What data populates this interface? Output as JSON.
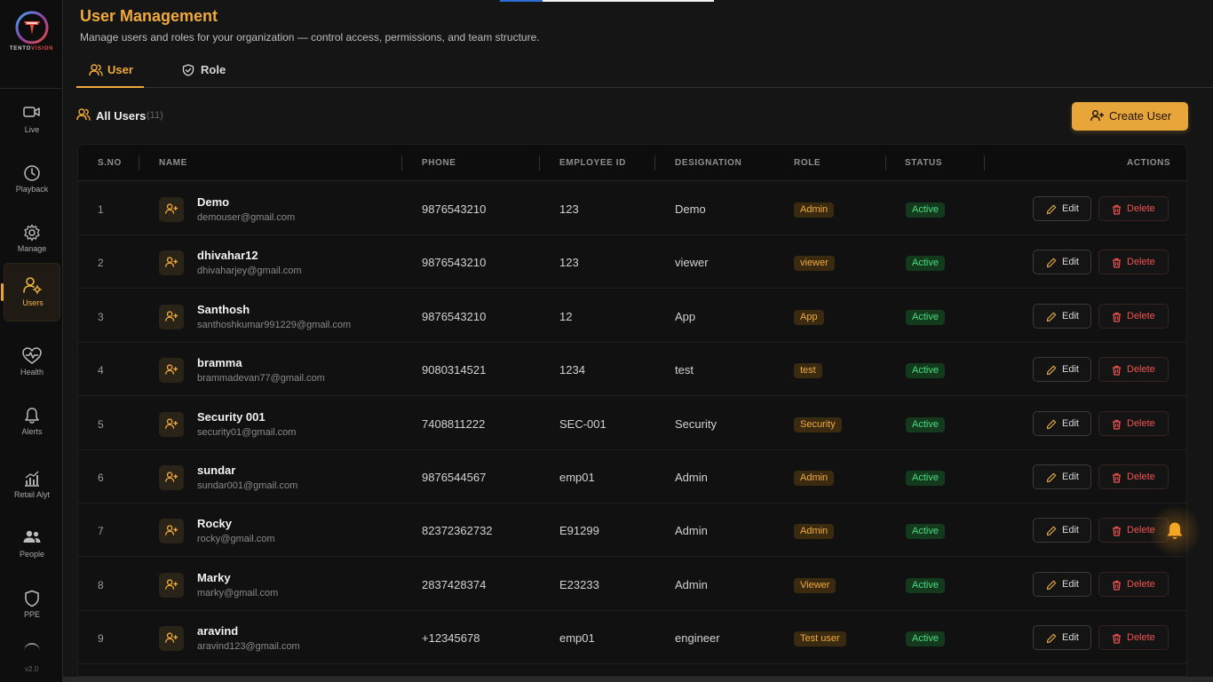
{
  "brand": {
    "name_part1": "TENTO",
    "name_part2": "VISION",
    "accent": "#f0a93a"
  },
  "sidebar": {
    "items": [
      {
        "label": "Live",
        "icon": "video-camera-icon"
      },
      {
        "label": "Playback",
        "icon": "clock-icon"
      },
      {
        "label": "Manage",
        "icon": "gear-icon"
      },
      {
        "label": "Users",
        "icon": "users-gear-icon",
        "active": true
      },
      {
        "label": "Health",
        "icon": "heart-pulse-icon"
      },
      {
        "label": "Alerts",
        "icon": "bell-icon"
      },
      {
        "label": "Retail Alyt",
        "icon": "bar-chart-icon"
      },
      {
        "label": "People",
        "icon": "people-icon"
      },
      {
        "label": "PPE",
        "icon": "shield-icon"
      }
    ],
    "version": "v2.0"
  },
  "top_progress": 0.2,
  "header": {
    "title": "User Management",
    "subtitle": "Manage users and roles for your organization — control access, permissions, and team structure."
  },
  "tabs": [
    {
      "label": "User",
      "icon": "users-icon",
      "active": true
    },
    {
      "label": "Role",
      "icon": "shield-check-icon"
    }
  ],
  "section": {
    "title": "All Users",
    "count": "(11)"
  },
  "create_button": {
    "label": "Create User",
    "icon": "user-plus-icon"
  },
  "table": {
    "columns": [
      "S.NO",
      "NAME",
      "PHONE",
      "EMPLOYEE ID",
      "DESIGNATION",
      "ROLE",
      "STATUS",
      "ACTIONS"
    ],
    "edit_label": "Edit",
    "delete_label": "Delete",
    "rows": [
      {
        "sno": "1",
        "name": "Demo",
        "email": "demouser@gmail.com",
        "phone": "9876543210",
        "emp_id": "123",
        "designation": "Demo",
        "role": "Admin",
        "status": "Active"
      },
      {
        "sno": "2",
        "name": "dhivahar12",
        "email": "dhivaharjey@gmail.com",
        "phone": "9876543210",
        "emp_id": "123",
        "designation": "viewer",
        "role": "viewer",
        "status": "Active"
      },
      {
        "sno": "3",
        "name": "Santhosh",
        "email": "santhoshkumar991229@gmail.com",
        "phone": "9876543210",
        "emp_id": "12",
        "designation": "App",
        "role": "App",
        "status": "Active"
      },
      {
        "sno": "4",
        "name": "bramma",
        "email": "brammadevan77@gmail.com",
        "phone": "9080314521",
        "emp_id": "1234",
        "designation": "test",
        "role": "test",
        "status": "Active"
      },
      {
        "sno": "5",
        "name": "Security 001",
        "email": "security01@gmail.com",
        "phone": "7408811222",
        "emp_id": "SEC-001",
        "designation": "Security",
        "role": "Security",
        "status": "Active"
      },
      {
        "sno": "6",
        "name": "sundar",
        "email": "sundar001@gmail.com",
        "phone": "9876544567",
        "emp_id": "emp01",
        "designation": "Admin",
        "role": "Admin",
        "status": "Active"
      },
      {
        "sno": "7",
        "name": "Rocky",
        "email": "rocky@gmail.com",
        "phone": "82372362732",
        "emp_id": "E91299",
        "designation": "Admin",
        "role": "Admin",
        "status": "Active"
      },
      {
        "sno": "8",
        "name": "Marky",
        "email": "marky@gmail.com",
        "phone": "2837428374",
        "emp_id": "E23233",
        "designation": "Admin",
        "role": "Viewer",
        "status": "Active"
      },
      {
        "sno": "9",
        "name": "aravind",
        "email": "aravind123@gmail.com",
        "phone": "+12345678",
        "emp_id": "emp01",
        "designation": "engineer",
        "role": "Test user",
        "status": "Active"
      }
    ]
  }
}
